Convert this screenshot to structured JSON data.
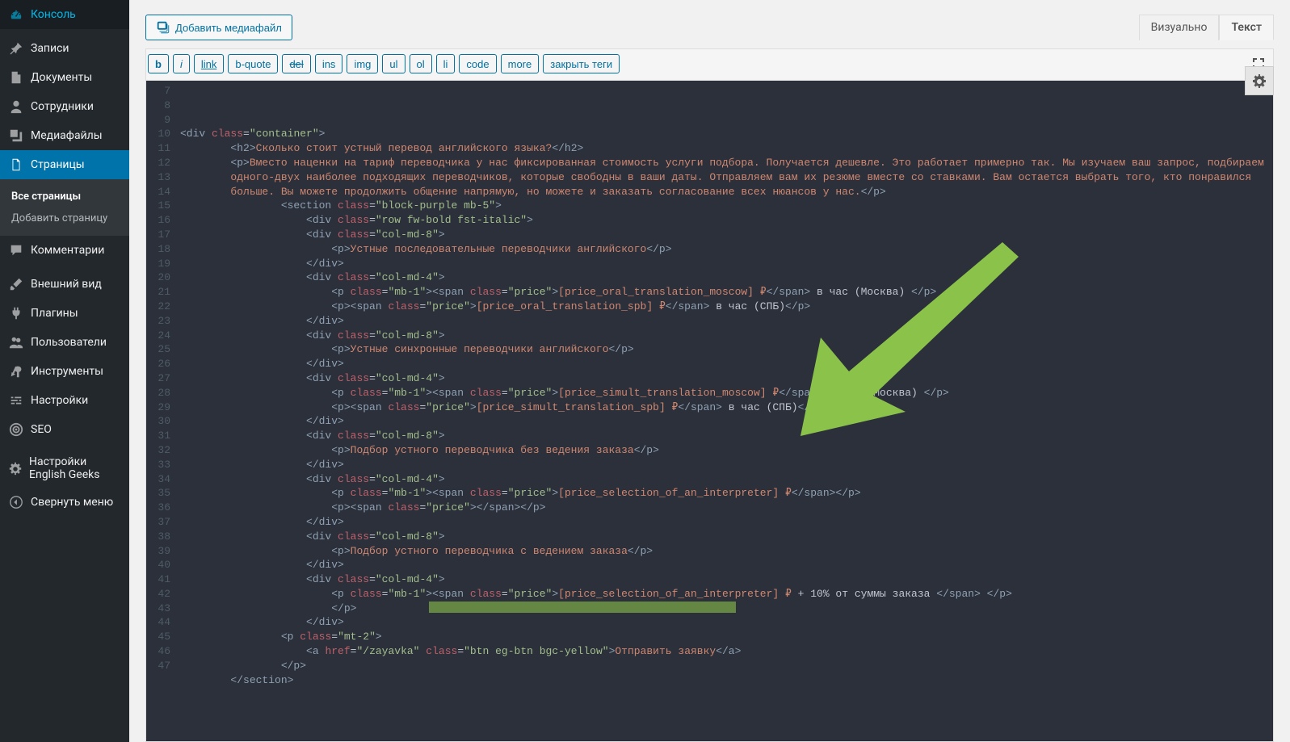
{
  "sidebar": {
    "items": [
      {
        "label": "Консоль",
        "icon": "dashboard"
      },
      {
        "label": "Записи",
        "icon": "pin"
      },
      {
        "label": "Документы",
        "icon": "doc"
      },
      {
        "label": "Сотрудники",
        "icon": "user"
      },
      {
        "label": "Медиафайлы",
        "icon": "media"
      },
      {
        "label": "Страницы",
        "icon": "pages",
        "active": true
      },
      {
        "label": "Комментарии",
        "icon": "comment"
      },
      {
        "label": "Внешний вид",
        "icon": "brush"
      },
      {
        "label": "Плагины",
        "icon": "plug"
      },
      {
        "label": "Пользователи",
        "icon": "users"
      },
      {
        "label": "Инструменты",
        "icon": "tool"
      },
      {
        "label": "Настройки",
        "icon": "slider"
      },
      {
        "label": "SEO",
        "icon": "target"
      },
      {
        "label": "Настройки English Geeks",
        "icon": "gear"
      },
      {
        "label": "Свернуть меню",
        "icon": "collapse"
      }
    ],
    "sub": {
      "all": "Все страницы",
      "add": "Добавить страницу"
    }
  },
  "toolbar": {
    "add_media": "Добавить медиафайл",
    "tabs": {
      "visual": "Визуально",
      "text": "Текст"
    },
    "quicktags": [
      "b",
      "i",
      "link",
      "b-quote",
      "del",
      "ins",
      "img",
      "ul",
      "ol",
      "li",
      "code",
      "more",
      "закрыть теги"
    ]
  },
  "gutter": {
    "start": 7,
    "end": 47
  },
  "code_lines": [
    [],
    [],
    [],
    [
      [
        "tag",
        "<div "
      ],
      [
        "attr",
        "class"
      ],
      [
        "br",
        "="
      ],
      [
        "str",
        "\"container\""
      ],
      [
        "tag",
        ">"
      ]
    ],
    [
      [
        "sp",
        "        "
      ],
      [
        "tag",
        "<h2>"
      ],
      [
        "txt",
        "Сколько стоит устный перевод английского языка?"
      ],
      [
        "tag",
        "</h2>"
      ]
    ],
    [
      [
        "sp",
        "        "
      ],
      [
        "tag",
        "<p>"
      ],
      [
        "txt",
        "Вместо наценки на тариф переводчика у нас фиксированная стоимость услуги подбора. Получается дешевле. Это работает примерно так. Мы изучаем ваш запрос, подбираем"
      ]
    ],
    [
      [
        "sp",
        "        "
      ],
      [
        "txt",
        "одного-двух наиболее подходящих переводчиков, которые свободны в ваши даты. Отправляем вам их резюме вместе со ставками. Вам остается выбрать того, кто понравился"
      ]
    ],
    [
      [
        "sp",
        "        "
      ],
      [
        "txt",
        "больше. Вы можете продолжить общение напрямую, но можете и заказать согласование всех нюансов у нас."
      ],
      [
        "tag",
        "</p>"
      ]
    ],
    [
      [
        "sp",
        "                "
      ],
      [
        "tag",
        "<section "
      ],
      [
        "attr",
        "class"
      ],
      [
        "br",
        "="
      ],
      [
        "str",
        "\"block-purple mb-5\""
      ],
      [
        "tag",
        ">"
      ]
    ],
    [
      [
        "sp",
        "                    "
      ],
      [
        "tag",
        "<div "
      ],
      [
        "attr",
        "class"
      ],
      [
        "br",
        "="
      ],
      [
        "str",
        "\"row fw-bold fst-italic\""
      ],
      [
        "tag",
        ">"
      ]
    ],
    [
      [
        "sp",
        "                    "
      ],
      [
        "tag",
        "<div "
      ],
      [
        "attr",
        "class"
      ],
      [
        "br",
        "="
      ],
      [
        "str",
        "\"col-md-8\""
      ],
      [
        "tag",
        ">"
      ]
    ],
    [
      [
        "sp",
        "                        "
      ],
      [
        "tag",
        "<p>"
      ],
      [
        "txt",
        "Устные последовательные переводчики английского"
      ],
      [
        "tag",
        "</p>"
      ]
    ],
    [
      [
        "sp",
        "                    "
      ],
      [
        "tag",
        "</div>"
      ]
    ],
    [
      [
        "sp",
        "                    "
      ],
      [
        "tag",
        "<div "
      ],
      [
        "attr",
        "class"
      ],
      [
        "br",
        "="
      ],
      [
        "str",
        "\"col-md-4\""
      ],
      [
        "tag",
        ">"
      ]
    ],
    [
      [
        "sp",
        "                        "
      ],
      [
        "tag",
        "<p "
      ],
      [
        "attr",
        "class"
      ],
      [
        "br",
        "="
      ],
      [
        "str",
        "\"mb-1\""
      ],
      [
        "tag",
        "><span "
      ],
      [
        "attr",
        "class"
      ],
      [
        "br",
        "="
      ],
      [
        "str",
        "\"price\""
      ],
      [
        "tag",
        ">"
      ],
      [
        "txt",
        "[price_oral_translation_moscow] ₽"
      ],
      [
        "tag",
        "</span>"
      ],
      [
        "br",
        " в час (Москва) "
      ],
      [
        "tag",
        "</p>"
      ]
    ],
    [
      [
        "sp",
        "                        "
      ],
      [
        "tag",
        "<p><span "
      ],
      [
        "attr",
        "class"
      ],
      [
        "br",
        "="
      ],
      [
        "str",
        "\"price\""
      ],
      [
        "tag",
        ">"
      ],
      [
        "txt",
        "[price_oral_translation_spb] ₽"
      ],
      [
        "tag",
        "</span>"
      ],
      [
        "br",
        " в час (СПБ)"
      ],
      [
        "tag",
        "</p>"
      ]
    ],
    [
      [
        "sp",
        "                    "
      ],
      [
        "tag",
        "</div>"
      ]
    ],
    [
      [
        "sp",
        "                    "
      ],
      [
        "tag",
        "<div "
      ],
      [
        "attr",
        "class"
      ],
      [
        "br",
        "="
      ],
      [
        "str",
        "\"col-md-8\""
      ],
      [
        "tag",
        ">"
      ]
    ],
    [
      [
        "sp",
        "                        "
      ],
      [
        "tag",
        "<p>"
      ],
      [
        "txt",
        "Устные синхронные переводчики английского"
      ],
      [
        "tag",
        "</p>"
      ]
    ],
    [
      [
        "sp",
        "                    "
      ],
      [
        "tag",
        "</div>"
      ]
    ],
    [
      [
        "sp",
        "                    "
      ],
      [
        "tag",
        "<div "
      ],
      [
        "attr",
        "class"
      ],
      [
        "br",
        "="
      ],
      [
        "str",
        "\"col-md-4\""
      ],
      [
        "tag",
        ">"
      ]
    ],
    [
      [
        "sp",
        "                        "
      ],
      [
        "tag",
        "<p "
      ],
      [
        "attr",
        "class"
      ],
      [
        "br",
        "="
      ],
      [
        "str",
        "\"mb-1\""
      ],
      [
        "tag",
        "><span "
      ],
      [
        "attr",
        "class"
      ],
      [
        "br",
        "="
      ],
      [
        "str",
        "\"price\""
      ],
      [
        "tag",
        ">"
      ],
      [
        "txt",
        "[price_simult_translation_moscow] ₽"
      ],
      [
        "tag",
        "</span>"
      ],
      [
        "br",
        " в час (Москва) "
      ],
      [
        "tag",
        "</p>"
      ]
    ],
    [
      [
        "sp",
        "                        "
      ],
      [
        "tag",
        "<p><span "
      ],
      [
        "attr",
        "class"
      ],
      [
        "br",
        "="
      ],
      [
        "str",
        "\"price\""
      ],
      [
        "tag",
        ">"
      ],
      [
        "txt",
        "[price_simult_translation_spb] ₽"
      ],
      [
        "tag",
        "</span>"
      ],
      [
        "br",
        " в час (СПБ)"
      ],
      [
        "tag",
        "</p>"
      ]
    ],
    [
      [
        "sp",
        "                    "
      ],
      [
        "tag",
        "</div>"
      ]
    ],
    [
      [
        "sp",
        "                    "
      ],
      [
        "tag",
        "<div "
      ],
      [
        "attr",
        "class"
      ],
      [
        "br",
        "="
      ],
      [
        "str",
        "\"col-md-8\""
      ],
      [
        "tag",
        ">"
      ]
    ],
    [
      [
        "sp",
        "                        "
      ],
      [
        "tag",
        "<p>"
      ],
      [
        "txt",
        "Подбор устного переводчика без ведения заказа"
      ],
      [
        "tag",
        "</p>"
      ]
    ],
    [
      [
        "sp",
        "                    "
      ],
      [
        "tag",
        "</div>"
      ]
    ],
    [
      [
        "sp",
        "                    "
      ],
      [
        "tag",
        "<div "
      ],
      [
        "attr",
        "class"
      ],
      [
        "br",
        "="
      ],
      [
        "str",
        "\"col-md-4\""
      ],
      [
        "tag",
        ">"
      ]
    ],
    [
      [
        "sp",
        "                        "
      ],
      [
        "tag",
        "<p "
      ],
      [
        "attr",
        "class"
      ],
      [
        "br",
        "="
      ],
      [
        "str",
        "\"mb-1\""
      ],
      [
        "tag",
        "><span "
      ],
      [
        "attr",
        "class"
      ],
      [
        "br",
        "="
      ],
      [
        "str",
        "\"price\""
      ],
      [
        "tag",
        ">"
      ],
      [
        "txt",
        "[price_selection_of_an_interpreter] ₽"
      ],
      [
        "tag",
        "</span></p>"
      ]
    ],
    [
      [
        "sp",
        "                        "
      ],
      [
        "tag",
        "<p><span "
      ],
      [
        "attr",
        "class"
      ],
      [
        "br",
        "="
      ],
      [
        "str",
        "\"price\""
      ],
      [
        "tag",
        "></span></p>"
      ]
    ],
    [
      [
        "sp",
        "                    "
      ],
      [
        "tag",
        "</div>"
      ]
    ],
    [
      [
        "sp",
        "                    "
      ],
      [
        "tag",
        "<div "
      ],
      [
        "attr",
        "class"
      ],
      [
        "br",
        "="
      ],
      [
        "str",
        "\"col-md-8\""
      ],
      [
        "tag",
        ">"
      ]
    ],
    [
      [
        "sp",
        "                        "
      ],
      [
        "tag",
        "<p>"
      ],
      [
        "txt",
        "Подбор устного переводчика с ведением заказа"
      ],
      [
        "tag",
        "</p>"
      ]
    ],
    [
      [
        "sp",
        "                    "
      ],
      [
        "tag",
        "</div>"
      ]
    ],
    [
      [
        "sp",
        "                    "
      ],
      [
        "tag",
        "<div "
      ],
      [
        "attr",
        "class"
      ],
      [
        "br",
        "="
      ],
      [
        "str",
        "\"col-md-4\""
      ],
      [
        "tag",
        ">"
      ]
    ],
    [
      [
        "sp",
        "                        "
      ],
      [
        "tag",
        "<p "
      ],
      [
        "attr",
        "class"
      ],
      [
        "br",
        "="
      ],
      [
        "str",
        "\"mb-1\""
      ],
      [
        "tag",
        "><span "
      ],
      [
        "attr",
        "class"
      ],
      [
        "br",
        "="
      ],
      [
        "str",
        "\"price\""
      ],
      [
        "tag",
        ">"
      ],
      [
        "txt",
        "[price_selection_of_an_interpreter] ₽"
      ],
      [
        "br",
        " + 10% от суммы заказа "
      ],
      [
        "tag",
        "</span> </p>"
      ]
    ],
    [
      [
        "sp",
        "                        "
      ],
      [
        "tag",
        "</p>"
      ]
    ],
    [
      [
        "sp",
        "                    "
      ],
      [
        "tag",
        "</div>"
      ]
    ],
    [
      [
        "sp",
        "                "
      ],
      [
        "tag",
        "<p "
      ],
      [
        "attr",
        "class"
      ],
      [
        "br",
        "="
      ],
      [
        "str",
        "\"mt-2\""
      ],
      [
        "tag",
        ">"
      ]
    ],
    [
      [
        "sp",
        "                    "
      ],
      [
        "tag",
        "<a "
      ],
      [
        "attr",
        "href"
      ],
      [
        "br",
        "="
      ],
      [
        "str",
        "\"/zayavka\""
      ],
      [
        "br",
        " "
      ],
      [
        "attr",
        "class"
      ],
      [
        "br",
        "="
      ],
      [
        "str",
        "\"btn eg-btn bgc-yellow\""
      ],
      [
        "tag",
        ">"
      ],
      [
        "txt",
        "Отправить заявку"
      ],
      [
        "tag",
        "</a>"
      ]
    ],
    [
      [
        "sp",
        "                "
      ],
      [
        "tag",
        "</p>"
      ]
    ],
    [
      [
        "sp",
        "        "
      ],
      [
        "tag",
        "</section>"
      ]
    ],
    []
  ]
}
